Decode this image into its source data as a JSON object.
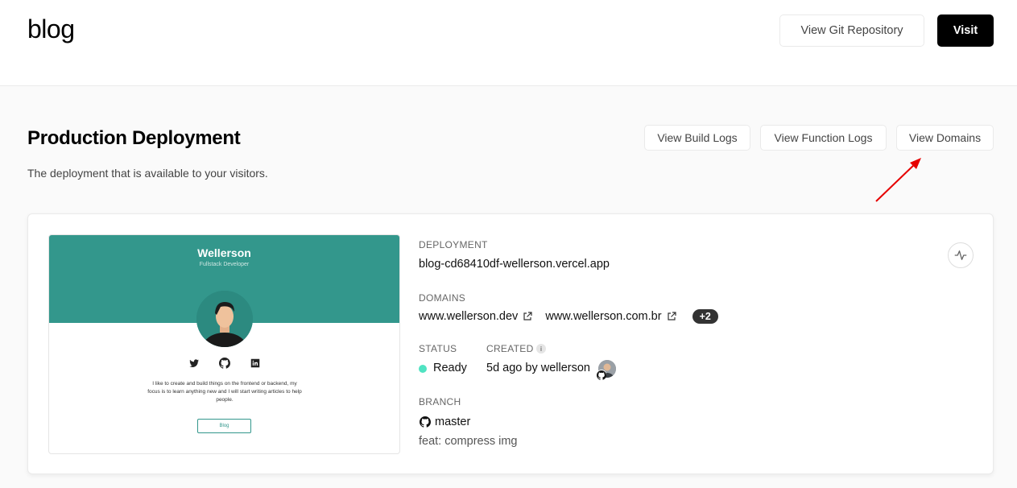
{
  "header": {
    "project_name": "blog",
    "git_button_label": "View Git Repository",
    "visit_button_label": "Visit"
  },
  "production": {
    "title": "Production Deployment",
    "subtitle": "The deployment that is available to your visitors.",
    "build_logs_label": "View Build Logs",
    "function_logs_label": "View Function Logs",
    "domains_label": "View Domains"
  },
  "preview": {
    "name": "Wellerson",
    "role": "Fullstack Developer",
    "bio": "I like to create and build things on the frontend or backend, my focus is to learn anything new and I will start writing articles to help people.",
    "button_label": "Blog",
    "social_icons": [
      "twitter-icon",
      "github-icon",
      "linkedin-icon"
    ]
  },
  "deployment": {
    "deployment_label": "DEPLOYMENT",
    "deployment_url": "blog-cd68410df-wellerson.vercel.app",
    "domains_label": "DOMAINS",
    "domains": [
      "www.wellerson.dev",
      "www.wellerson.com.br"
    ],
    "domains_more": "+2",
    "status_label": "STATUS",
    "status_value": "Ready",
    "status_color": "#50e3c2",
    "created_label": "CREATED",
    "info_icon_glyph": "i",
    "created_value": "5d ago by wellerson",
    "branch_label": "BRANCH",
    "branch_name": "master",
    "commit_message": "feat: compress img"
  },
  "colors": {
    "accent": "#000000",
    "preview_hero": "#33978c",
    "annotation_arrow": "#e60000"
  }
}
